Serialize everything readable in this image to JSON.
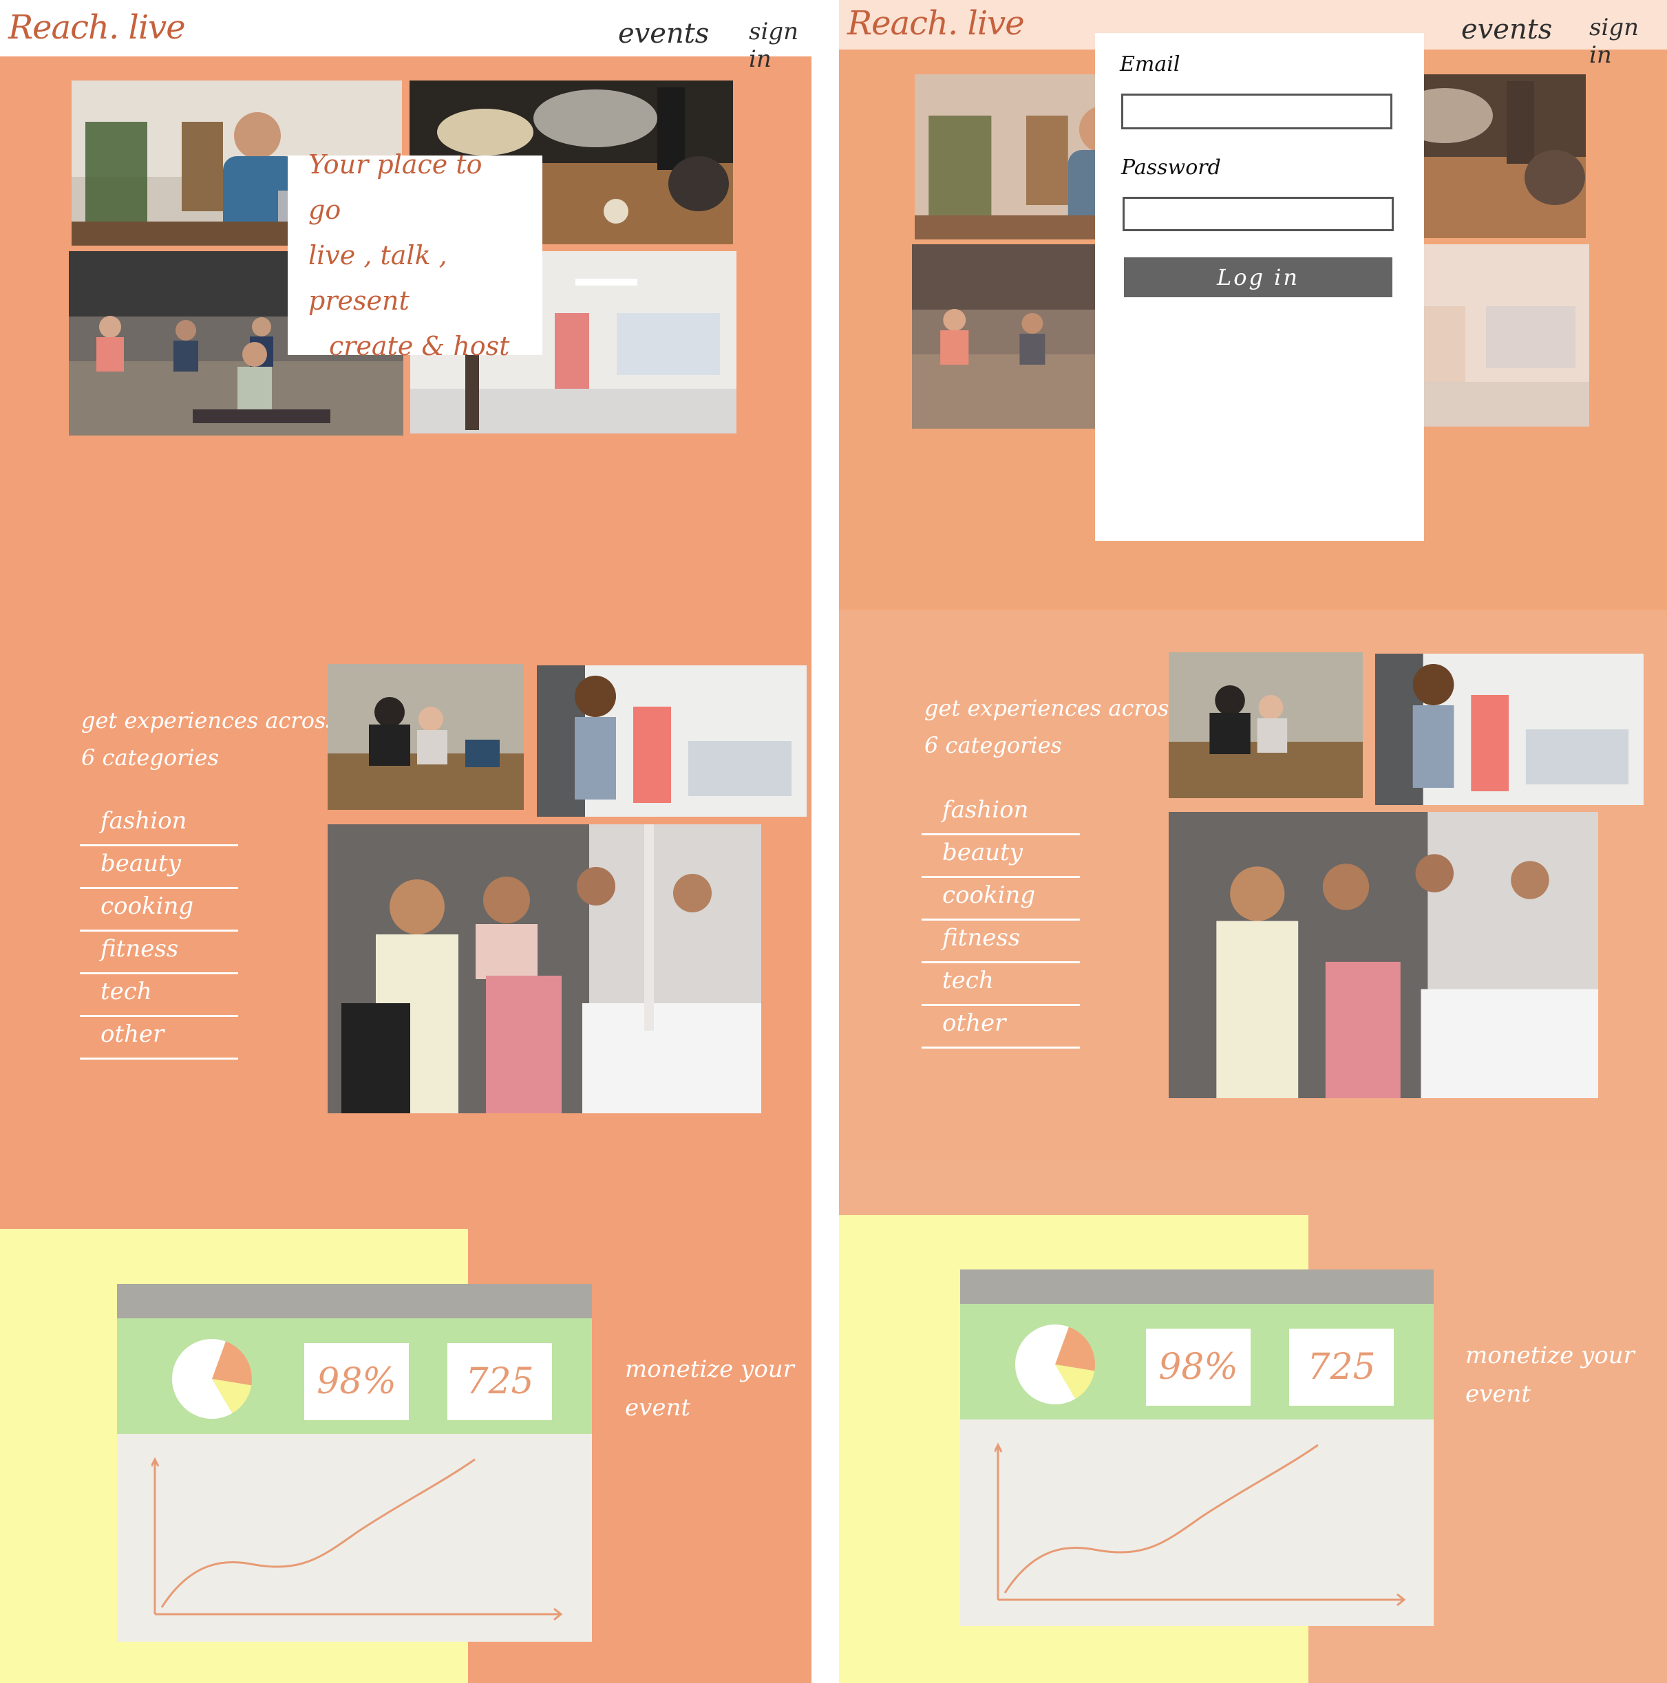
{
  "site": {
    "logo": "Reach. live",
    "nav": {
      "events": "events",
      "sign_in": "sign in"
    }
  },
  "hero": {
    "lines": [
      "Your place to go",
      "live , talk , present",
      "create & host"
    ]
  },
  "categories": {
    "title_lines": [
      "get experiences across",
      "6 categories"
    ],
    "items": [
      "fashion",
      "beauty",
      "cooking",
      "fitness",
      "tech",
      "other"
    ]
  },
  "monetize": {
    "lines": [
      "monetize your",
      "event"
    ],
    "stats": {
      "percent": "98%",
      "count": "725"
    },
    "pie_chart": {
      "type": "pie",
      "values": [
        22,
        14,
        64
      ]
    }
  },
  "login": {
    "email_label": "Email",
    "email_value": "",
    "password_label": "Password",
    "password_value": "",
    "button_label": "Log in"
  },
  "colors": {
    "accent": "#f2a077",
    "brand_text": "#c5613d",
    "yellow": "#fbfaa7",
    "green": "#bde3a2",
    "button": "#646464"
  },
  "images": [
    "man-on-video-call-photo",
    "cooking-ingredients-photo",
    "yoga-class-photo",
    "fashion-studio-photo",
    "craft-workshop-photo",
    "fashion-designer-photo",
    "makeup-class-photo"
  ]
}
